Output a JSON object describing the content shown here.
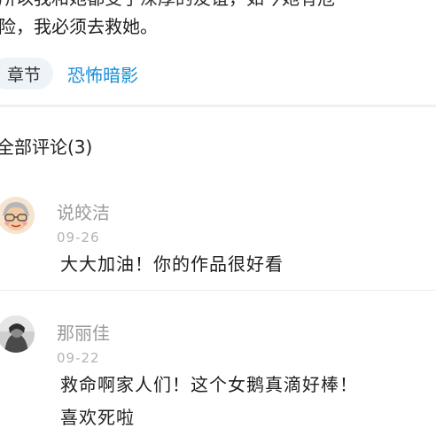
{
  "story": {
    "line_top": "所以我和她都受了深厚的友谊，如今她有危",
    "line_bottom": "险，我必须去救她。"
  },
  "tags": {
    "chip_label": "章节",
    "link_label": "恐怖暗影"
  },
  "comments_section": {
    "title": "全部评论(3)",
    "comments": [
      {
        "username": "说皎洁",
        "date": "09-26",
        "text_lines": [
          "大大加油！你的作品很好看"
        ]
      },
      {
        "username": "那丽佳",
        "date": "09-22",
        "text_lines": [
          "救命啊家人们！这个女鹅真滴好棒！",
          "喜欢死啦"
        ]
      }
    ]
  }
}
